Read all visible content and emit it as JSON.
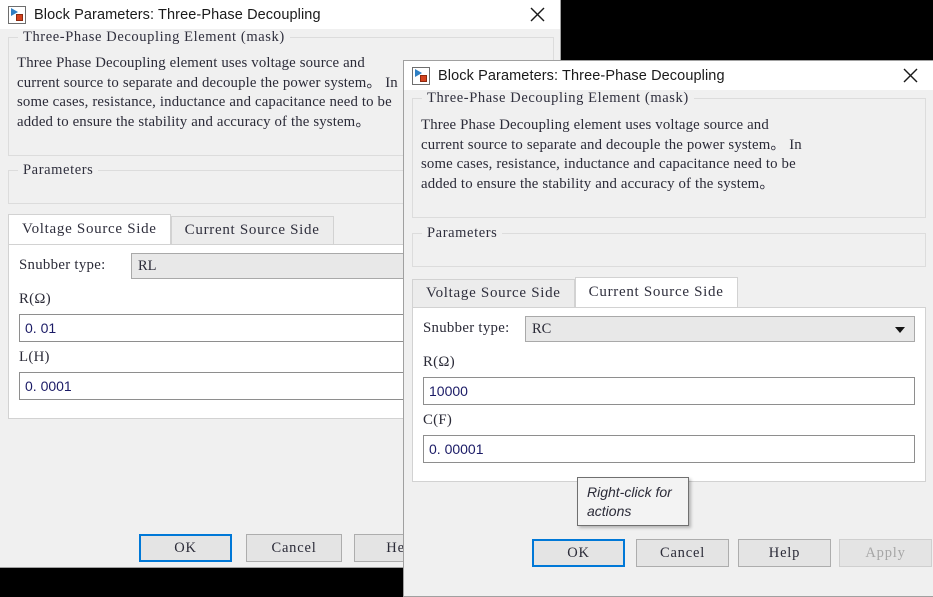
{
  "dialog_back": {
    "title": "Block Parameters: Three-Phase Decoupling",
    "mask_legend": "Three-Phase Decoupling Element (mask)",
    "description": "Three Phase Decoupling element uses voltage source and\ncurrent source to separate and decouple the power system。 In\nsome cases, resistance, inductance and capacitance need to be\nadded to ensure the stability and accuracy of the system。",
    "parameters_legend": "Parameters",
    "tabs": [
      {
        "label": "Voltage Source Side",
        "active": true
      },
      {
        "label": "Current Source Side",
        "active": false
      }
    ],
    "snubber_label": "Snubber type:",
    "snubber_value": "RL",
    "fields": [
      {
        "label": "R(Ω)",
        "value": "0. 01"
      },
      {
        "label": "L(H)",
        "value": "0. 0001"
      }
    ],
    "buttons": [
      {
        "label": "OK",
        "state": "default"
      },
      {
        "label": "Cancel",
        "state": "normal"
      },
      {
        "label": "Help",
        "state": "normal"
      }
    ],
    "close_icon": "close-icon"
  },
  "dialog_front": {
    "title": "Block Parameters: Three-Phase Decoupling",
    "mask_legend": "Three-Phase Decoupling Element (mask)",
    "description": "Three Phase Decoupling element uses voltage source and\ncurrent source to separate and decouple the power system。 In\nsome cases, resistance, inductance and capacitance need to be\nadded to ensure the stability and accuracy of the  system。",
    "parameters_legend": "Parameters",
    "tabs": [
      {
        "label": "Voltage Source Side",
        "active": false
      },
      {
        "label": "Current Source Side",
        "active": true
      }
    ],
    "snubber_label": "Snubber type:",
    "snubber_value": "RC",
    "fields": [
      {
        "label": "R(Ω)",
        "value": "10000"
      },
      {
        "label": "C(F)",
        "value": "0. 00001"
      }
    ],
    "buttons": [
      {
        "label": "OK",
        "state": "default"
      },
      {
        "label": "Cancel",
        "state": "normal"
      },
      {
        "label": "Help",
        "state": "normal"
      },
      {
        "label": "Apply",
        "state": "disabled"
      }
    ],
    "close_icon": "close-icon"
  },
  "tooltip": {
    "text": "Right-click for\nactions"
  },
  "colors": {
    "accent": "#0078d7",
    "dialog_face": "#f0f0f0",
    "field_text": "#1b1b66",
    "desktop": "#000000"
  }
}
